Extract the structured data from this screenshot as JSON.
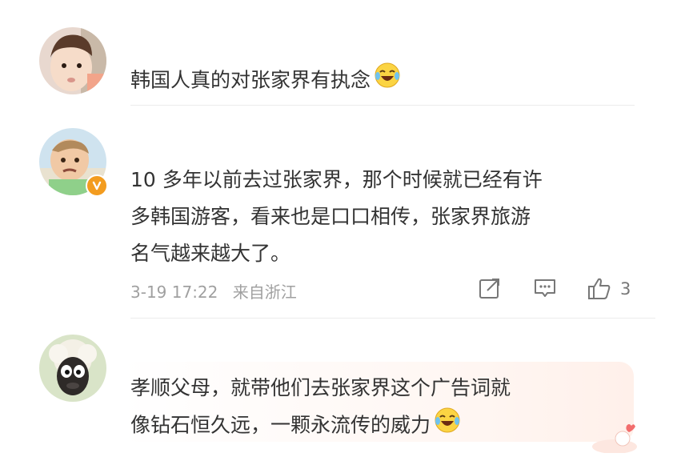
{
  "comments": [
    {
      "text": "韩国人真的对张家界有执念",
      "emoji": "laughing-tears-emoji"
    },
    {
      "text_line1": "10 多年以前去过张家界，那个时候就已经有许",
      "text_line2": "多韩国游客，看来也是口口相传，张家界旅游",
      "text_line3": "名气越来越大了。",
      "date": "3-19 17:22",
      "source": "来自浙江",
      "like_count": "3",
      "verified": true
    },
    {
      "text_line1": "孝顺父母，就带他们去张家界这个广告词就",
      "text_line2": "像钻石恒久远，一颗永流传的威力",
      "emoji": "laughing-tears-emoji"
    }
  ],
  "colors": {
    "badge": "#f39c1f",
    "text": "#333333",
    "meta": "#a0a0a0"
  }
}
